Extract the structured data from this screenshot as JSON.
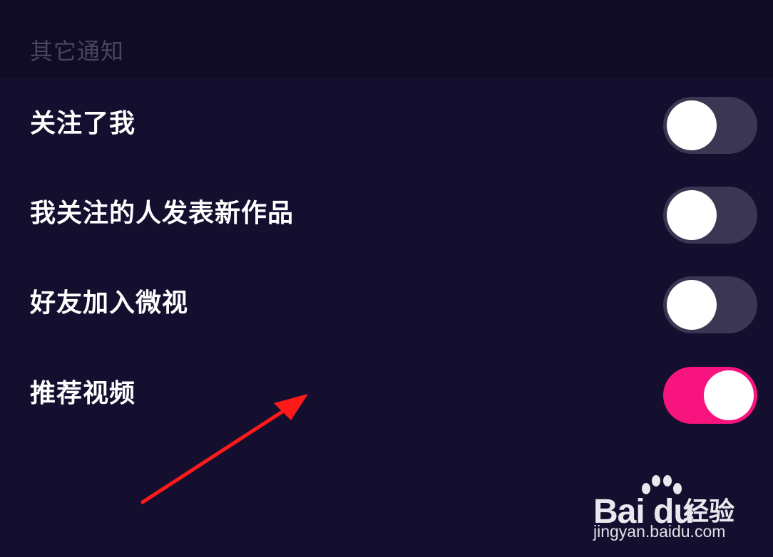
{
  "section": {
    "title": "其它通知"
  },
  "settings": [
    {
      "label": "关注了我",
      "enabled": false
    },
    {
      "label": "我关注的人发表新作品",
      "enabled": false
    },
    {
      "label": "好友加入微视",
      "enabled": false
    },
    {
      "label": "推荐视频",
      "enabled": true
    }
  ],
  "colors": {
    "background": "#150f2f",
    "header_background": "#110c26",
    "toggle_off": "#3b3652",
    "toggle_on": "#f8147e",
    "annotation_arrow": "#ff1a1a"
  },
  "watermark": {
    "brand": "Bai du",
    "product": "经验",
    "url": "jingyan.baidu.com"
  }
}
